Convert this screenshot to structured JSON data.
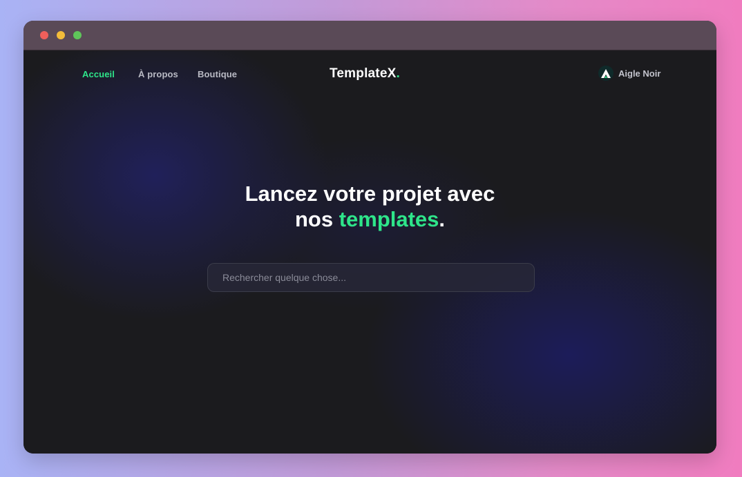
{
  "nav": {
    "links": [
      {
        "label": "Accueil"
      },
      {
        "label": "À propos"
      },
      {
        "label": "Boutique"
      }
    ]
  },
  "brand": {
    "name": "TemplateX",
    "suffix": "."
  },
  "profile": {
    "name": "Aigle Noir",
    "icon": "eagle-logo-icon"
  },
  "hero": {
    "line1": "Lancez votre projet avec",
    "line2_prefix": "nos ",
    "line2_accent": "templates",
    "line2_suffix": "."
  },
  "search": {
    "placeholder": "Rechercher quelque chose..."
  },
  "colors": {
    "accent": "#2ee58a",
    "background": "#1b1b1e"
  }
}
